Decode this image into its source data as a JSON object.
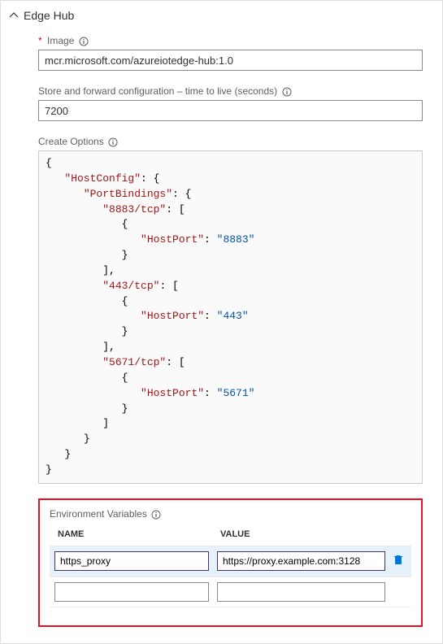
{
  "header": {
    "title": "Edge Hub"
  },
  "fields": {
    "image": {
      "label": "Image",
      "required_marker": "*",
      "value": "mcr.microsoft.com/azureiotedge-hub:1.0"
    },
    "ttl": {
      "label": "Store and forward configuration – time to live (seconds)",
      "value": "7200"
    },
    "create_options": {
      "label": "Create Options",
      "json": {
        "HostConfig": {
          "PortBindings": {
            "8883/tcp": [
              {
                "HostPort": "8883"
              }
            ],
            "443/tcp": [
              {
                "HostPort": "443"
              }
            ],
            "5671/tcp": [
              {
                "HostPort": "5671"
              }
            ]
          }
        }
      }
    }
  },
  "env": {
    "section_label": "Environment Variables",
    "columns": {
      "name": "NAME",
      "value": "VALUE"
    },
    "rows": [
      {
        "name": "https_proxy",
        "value": "https://proxy.example.com:3128",
        "active": true
      },
      {
        "name": "",
        "value": "",
        "active": false
      }
    ]
  },
  "icons": {
    "chevron_up": "chevron-up-icon",
    "info": "info-icon",
    "trash": "trash-icon"
  }
}
